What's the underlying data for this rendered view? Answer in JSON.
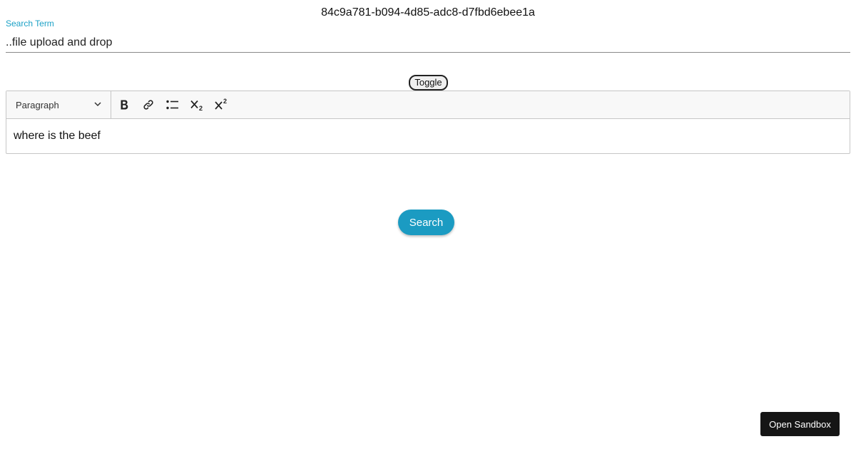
{
  "header": {
    "id_text": "84c9a781-b094-4d85-adc8-d7fbd6ebee1a"
  },
  "search_field": {
    "label": "Search Term",
    "value": "..file upload and drop"
  },
  "toggle": {
    "label": "Toggle"
  },
  "editor": {
    "heading_select": "Paragraph",
    "tools": [
      "bold-icon",
      "link-icon",
      "bulleted-list-icon",
      "subscript-icon",
      "superscript-icon"
    ],
    "content": "where is the beef"
  },
  "search_button": {
    "label": "Search"
  },
  "sandbox_button": {
    "label": "Open Sandbox"
  },
  "colors": {
    "accent": "#1b9bc2",
    "label": "#1ba1c6",
    "dark_button": "#151515"
  }
}
